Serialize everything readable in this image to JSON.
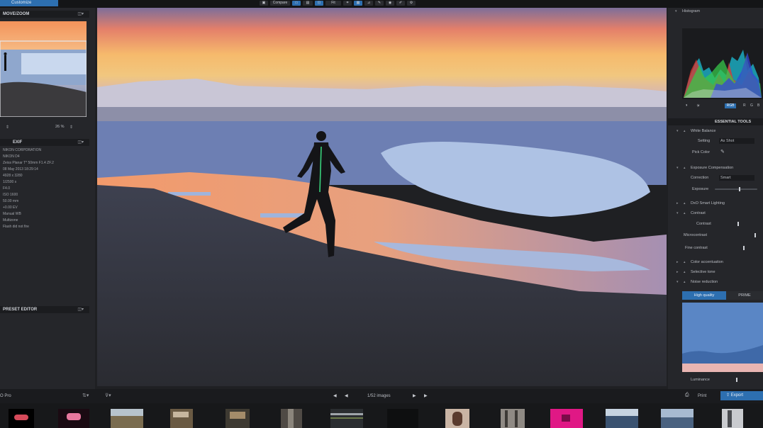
{
  "toolbar": {
    "customize_label": "Customize",
    "compare_label": "Compare",
    "zoom_label": "Fit"
  },
  "left_panel": {
    "move_zoom_title": "MOVE/ZOOM",
    "zoom_value": "26 %",
    "exif_title": "EXIF",
    "exif_lines": [
      "NIKON CORPORATION",
      "NIKON D4",
      "Zeiss Planar T* 50mm F1.4 ZF.2",
      "08 May 2013 18:29:14",
      "4928 x 3280",
      "1/2500 s",
      "F4.0",
      "ISO 1600",
      "50.00 mm",
      "+0.00 EV",
      "Manual WB",
      "Multizone",
      "Flash did not fire"
    ],
    "preset_editor_title": "PRESET EDITOR"
  },
  "right_panel": {
    "histogram_title": "Histogram",
    "histogram_channels": [
      "RGB",
      "R",
      "G",
      "B"
    ],
    "essential_tools_title": "ESSENTIAL TOOLS",
    "white_balance_label": "White Balance",
    "wb_setting_label": "Setting",
    "wb_setting_value": "As Shot",
    "pick_color_label": "Pick Color",
    "exposure_label": "Exposure Compensation",
    "correction_label": "Correction",
    "correction_value": "Smart",
    "exposure_sub_label": "Exposure",
    "smart_lighting_label": "DxO Smart Lighting",
    "contrast_label": "Contrast",
    "contrast_sub_label": "Contrast",
    "microcontrast_label": "Microcontrast",
    "fine_contrast_label": "Fine contrast",
    "color_accentuation_label": "Color accentuation",
    "selective_tone_label": "Selective tone",
    "noise_reduction_label": "Noise reduction",
    "hq_label": "High quality",
    "prime_label": "PRIME",
    "luminance_label": "Luminance"
  },
  "bottom_bar": {
    "app_label": "O Pro",
    "image_count": "1/52 images",
    "print_label": "Print",
    "export_label": "Export"
  },
  "colors": {
    "accent": "#2d6fb0",
    "panel": "#25262a",
    "panel_header": "#1b1c1f"
  }
}
